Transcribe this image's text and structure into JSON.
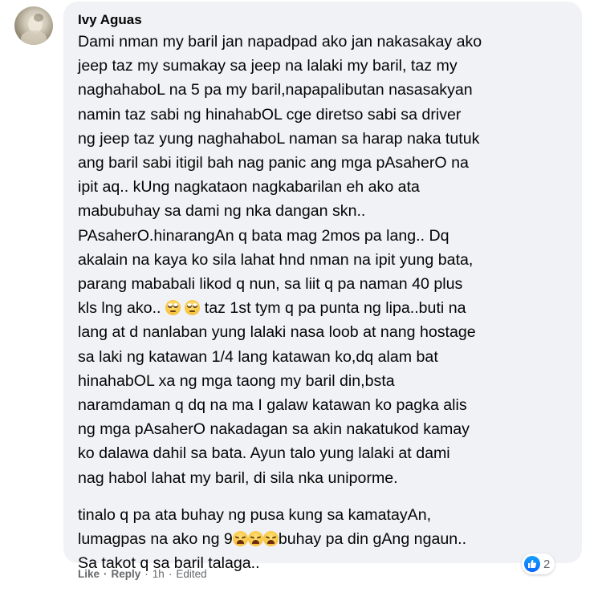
{
  "comment": {
    "author": "Ivy Aguas",
    "paragraphs": [
      {
        "lines": [
          [
            "Dami nman my baril jan napadpad ako jan nakasakay ako"
          ],
          [
            "jeep taz my sumakay sa jeep na lalaki my baril, taz my"
          ],
          [
            "naghahaboL na 5 pa my baril,napapalibutan nasasakyan"
          ],
          [
            "namin taz sabi ng hinahabOL cge diretso sabi sa driver"
          ],
          [
            "ng jeep taz yung naghahaboL naman sa harap naka tutuk"
          ],
          [
            "ang baril sabi itigil bah nag panic ang mga pAsaherO na"
          ],
          [
            "ipit aq.. kUng nagkataon nagkabarilan eh ako ata"
          ],
          [
            "mabubuhay sa dami ng nka dangan skn.."
          ],
          [
            "PAsaherO.hinarangAn q bata mag 2mos pa lang.. Dq"
          ],
          [
            "akalain na kaya ko sila lahat hnd nman na ipit yung bata,"
          ],
          [
            "parang mababali likod q nun, sa liit q pa naman 40 plus"
          ],
          [
            "kls lng ako.. ",
            " ",
            " taz 1st tym q pa punta ng lipa..buti na"
          ],
          [
            "lang at d nanlaban yung lalaki nasa loob at nang hostage"
          ],
          [
            "sa laki ng katawan 1/4 lang katawan ko,dq alam bat"
          ],
          [
            "hinahabOL xa ng mga taong my baril din,bsta"
          ],
          [
            "naramdaman q dq na ma I galaw katawan ko pagka alis"
          ],
          [
            "ng mga pAsaherO nakadagan sa akin nakatukod kamay"
          ],
          [
            "ko dalawa dahil sa bata. Ayun talo yung lalaki at dami"
          ],
          [
            "nag habol lahat my baril, di sila nka uniporme."
          ]
        ]
      },
      {
        "lines": [
          [
            "tinalo q pa ata buhay ng pusa kung sa kamatayAn,"
          ],
          [
            "lumagpas na ako ng 9",
            "buhay pa din gAng ngaun.."
          ],
          [
            "Sa takot q sa baril talaga.."
          ]
        ]
      }
    ],
    "emoji": {
      "roll": "face-with-rolling-eyes-emoji",
      "sad": "disappointed-face-emoji"
    },
    "reaction_count": "2",
    "actions": {
      "like": "Like",
      "reply": "Reply",
      "time": "1h",
      "edited": "Edited",
      "sep": "·"
    }
  },
  "colors": {
    "bubble": "#f0f2f5",
    "text": "#050505",
    "meta": "#65676b",
    "like_blue": "#0866ff"
  }
}
